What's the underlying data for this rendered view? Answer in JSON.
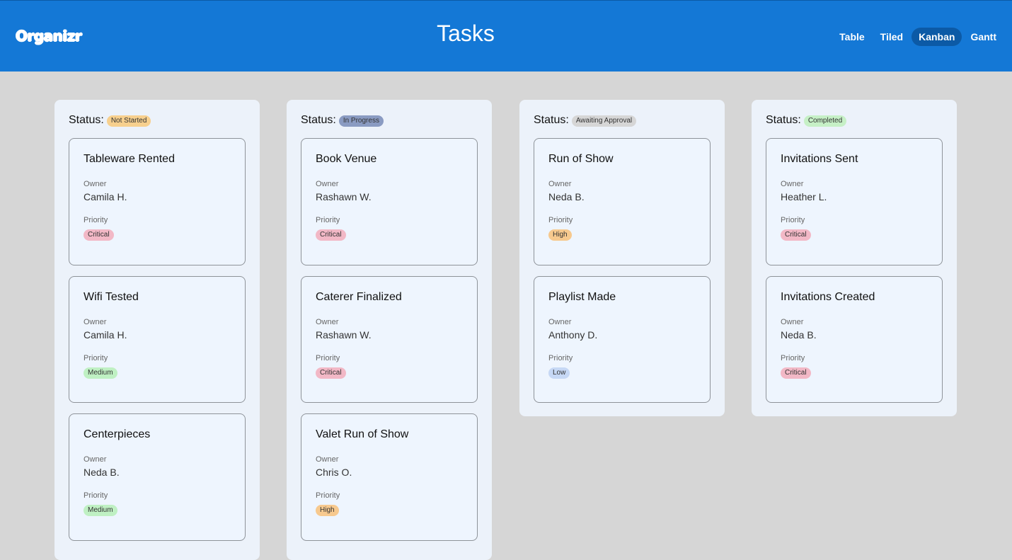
{
  "header": {
    "logo": "Organizr",
    "title": "Tasks",
    "nav": [
      {
        "label": "Table",
        "active": false
      },
      {
        "label": "Tiled",
        "active": false
      },
      {
        "label": "Kanban",
        "active": true
      },
      {
        "label": "Gantt",
        "active": false
      }
    ]
  },
  "labels": {
    "status": "Status:",
    "owner": "Owner",
    "priority": "Priority"
  },
  "colors": {
    "header_bg": "#1478d6",
    "nav_active_bg": "#0c5aa6",
    "status": {
      "Not Started": "#f7d08e",
      "In Progress": "#8a9bc2",
      "Awaiting Approval": "#d6d6d6",
      "Completed": "#c6f0c6"
    },
    "priority": {
      "Critical": "#f2b8c6",
      "High": "#f7c98e",
      "Medium": "#bff0c3",
      "Low": "#c6d8f5"
    }
  },
  "columns": [
    {
      "status": "Not Started",
      "cards": [
        {
          "title": "Tableware Rented",
          "owner": "Camila H.",
          "priority": "Critical"
        },
        {
          "title": "Wifi Tested",
          "owner": "Camila H.",
          "priority": "Medium"
        },
        {
          "title": "Centerpieces",
          "owner": "Neda B.",
          "priority": "Medium"
        }
      ]
    },
    {
      "status": "In Progress",
      "cards": [
        {
          "title": "Book Venue",
          "owner": "Rashawn W.",
          "priority": "Critical"
        },
        {
          "title": "Caterer Finalized",
          "owner": "Rashawn W.",
          "priority": "Critical"
        },
        {
          "title": "Valet Run of Show",
          "owner": "Chris O.",
          "priority": "High"
        }
      ]
    },
    {
      "status": "Awaiting Approval",
      "cards": [
        {
          "title": "Run of Show",
          "owner": "Neda B.",
          "priority": "High"
        },
        {
          "title": "Playlist Made",
          "owner": "Anthony D.",
          "priority": "Low"
        }
      ]
    },
    {
      "status": "Completed",
      "cards": [
        {
          "title": "Invitations Sent",
          "owner": "Heather L.",
          "priority": "Critical"
        },
        {
          "title": "Invitations Created",
          "owner": "Neda B.",
          "priority": "Critical"
        }
      ]
    }
  ]
}
